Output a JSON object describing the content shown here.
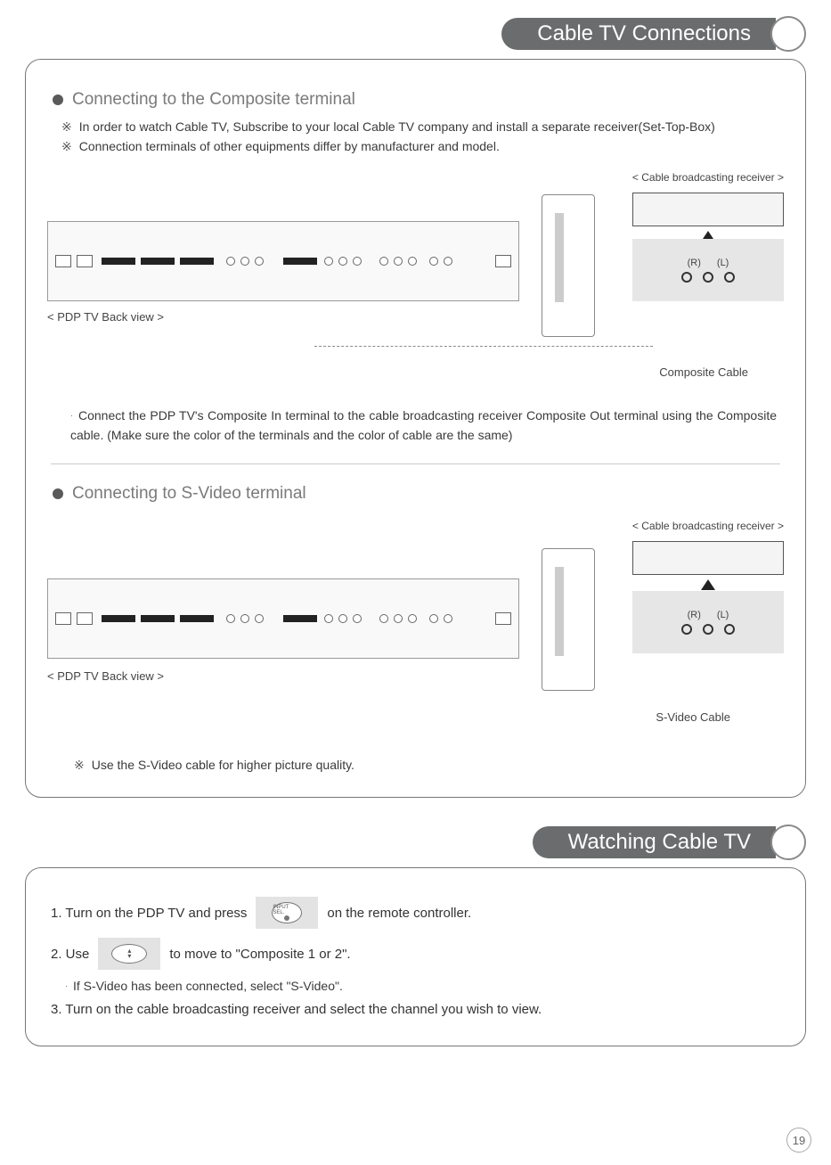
{
  "header1": {
    "title": "Cable TV Connections"
  },
  "section1": {
    "heading": "Connecting to the Composite terminal",
    "note_marker": "※",
    "note1": "In order to watch Cable TV, Subscribe to your local Cable TV company and install a separate receiver(Set-Top-Box)",
    "note2": "Connection terminals of other equipments differ by manufacturer and model.",
    "backview_label": "< PDP TV Back view >",
    "receiver_label": "< Cable broadcasting receiver >",
    "rl_r": "(R)",
    "rl_l": "(L)",
    "cable_label": "Composite Cable",
    "body_marker": "·",
    "body": "Connect the PDP TV's Composite In terminal to the cable broadcasting receiver Composite Out terminal using the Composite cable. (Make sure the color of the terminals and the color of cable are the same)"
  },
  "section2": {
    "heading": "Connecting to S-Video terminal",
    "backview_label": "< PDP TV Back view >",
    "receiver_label": "< Cable broadcasting receiver >",
    "rl_r": "(R)",
    "rl_l": "(L)",
    "cable_label": "S-Video Cable",
    "note_marker": "※",
    "note": "Use the S-Video cable for higher picture quality."
  },
  "header2": {
    "title": "Watching Cable TV"
  },
  "watch": {
    "step1_a": "1. Turn on the PDP TV and press",
    "step1_b": "on the remote controller.",
    "btn1_label": "INPUT SEL.",
    "step2_a": "2. Use",
    "step2_b": "to move to \"Composite 1 or 2\".",
    "sub_marker": "·",
    "sub": "If S-Video has been connected, select \"S-Video\".",
    "step3": "3. Turn on the cable broadcasting receiver and select the channel you wish to view."
  },
  "page_number": "19"
}
